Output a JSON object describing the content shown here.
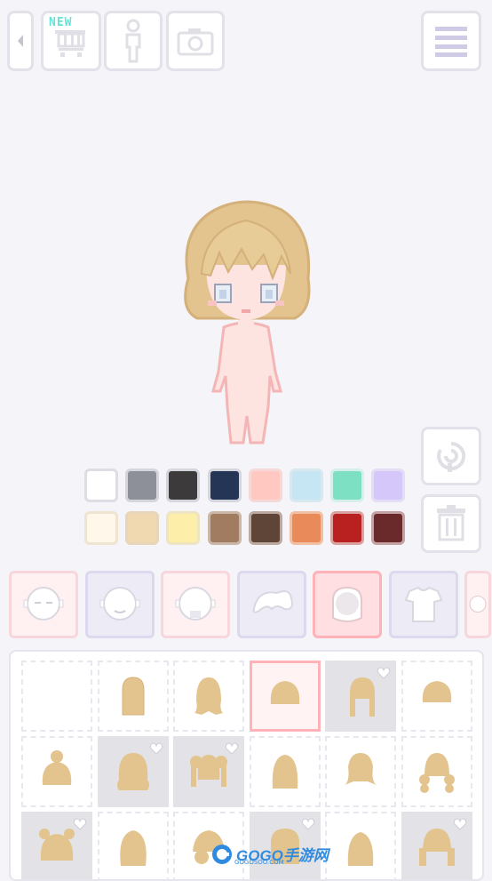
{
  "top_bar": {
    "back_icon": "back-arrow-icon",
    "shop_icon": "cart-icon",
    "new_badge": "NEW",
    "body_icon": "body-silhouette-icon",
    "camera_icon": "camera-icon",
    "menu_icon": "menu-icon"
  },
  "side_buttons": {
    "rotate_icon": "rotate-icon",
    "trash_icon": "trash-icon"
  },
  "palette": [
    [
      "#ffffff",
      "#8d9098",
      "#3c3a3a",
      "#253556",
      "#ffc9c2",
      "#c6e6f3",
      "#7de0c3",
      "#d6c7fb"
    ],
    [
      "#fff8ea",
      "#f0d8b0",
      "#fdeeaa",
      "#a27c60",
      "#5f4438",
      "#e88a5a",
      "#b8211f",
      "#6a2a2c"
    ]
  ],
  "palette_borders": [
    [
      "#dedde4",
      "#d5d5dd",
      "#d5d5dd",
      "#d5d5dd",
      "#f5d8d8",
      "#d8e8ef",
      "#d6efe8",
      "#e3ddf5"
    ],
    [
      "#eee4cf",
      "#e8d6bb",
      "#eee4c1",
      "#cbb7a7",
      "#bca9a0",
      "#f1bfa4",
      "#d9a2a1",
      "#c3a3a4"
    ]
  ],
  "category_tabs": [
    {
      "name": "tab-face-eyes",
      "icon": "face-eyes-icon"
    },
    {
      "name": "tab-face-mouth",
      "icon": "face-mouth-icon"
    },
    {
      "name": "tab-face-blush",
      "icon": "face-blush-icon"
    },
    {
      "name": "tab-bangs",
      "icon": "bangs-icon"
    },
    {
      "name": "tab-hair",
      "icon": "hair-icon"
    },
    {
      "name": "tab-top",
      "icon": "shirt-icon"
    },
    {
      "name": "tab-more",
      "icon": "more-icon"
    }
  ],
  "hair_items": [
    {
      "style": "none",
      "locked": false,
      "selected": false
    },
    {
      "style": "long",
      "locked": false,
      "selected": false
    },
    {
      "style": "long-wavy",
      "locked": false,
      "selected": false
    },
    {
      "style": "bob",
      "locked": false,
      "selected": true
    },
    {
      "style": "braids",
      "locked": true,
      "selected": false
    },
    {
      "style": "bob-short",
      "locked": false,
      "selected": false
    },
    {
      "style": "bun",
      "locked": false,
      "selected": false
    },
    {
      "style": "curly-long",
      "locked": true,
      "selected": false
    },
    {
      "style": "twin-tails",
      "locked": true,
      "selected": false
    },
    {
      "style": "medium",
      "locked": false,
      "selected": false
    },
    {
      "style": "flip",
      "locked": false,
      "selected": false
    },
    {
      "style": "side-puffs",
      "locked": false,
      "selected": false
    },
    {
      "style": "bear-ears",
      "locked": true,
      "selected": false
    },
    {
      "style": "messy",
      "locked": false,
      "selected": false
    },
    {
      "style": "side-bun",
      "locked": false,
      "selected": false
    },
    {
      "style": "straight",
      "locked": true,
      "selected": false
    },
    {
      "style": "medium-long",
      "locked": false,
      "selected": false
    },
    {
      "style": "twin-buns",
      "locked": true,
      "selected": false
    }
  ],
  "watermark": {
    "brand": "GOGO手游网",
    "sub": "GOGOSOO.COM"
  },
  "colors": {
    "hair": "#e3c48e",
    "skin": "#fde4e0",
    "accent_pink": "#ffb3b8",
    "accent_purple": "#d8d2f0"
  }
}
